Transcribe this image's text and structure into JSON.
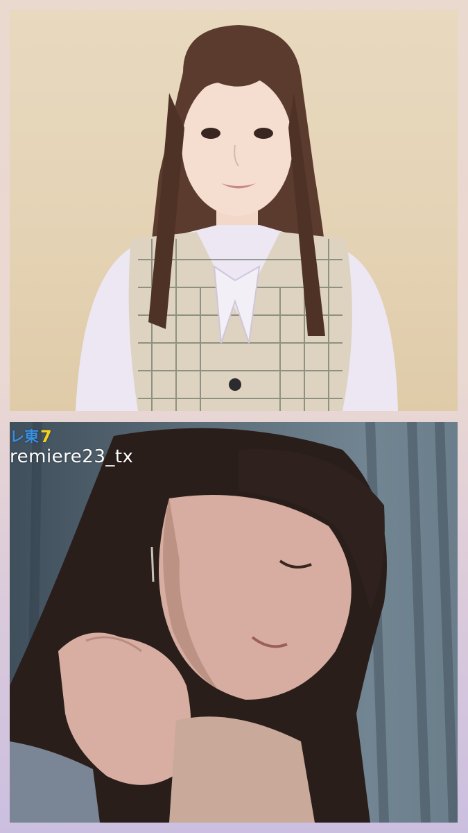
{
  "top_panel": {
    "description_colors": {
      "background": "#e6d6b9",
      "hair": "#5a3a2c",
      "blouse": "#ece6f2",
      "vest": "#ddd4c3"
    }
  },
  "bottom_panel": {
    "watermark": {
      "logo_text": "レ東",
      "logo_mark": "7",
      "handle": "remiere23_tx"
    }
  }
}
